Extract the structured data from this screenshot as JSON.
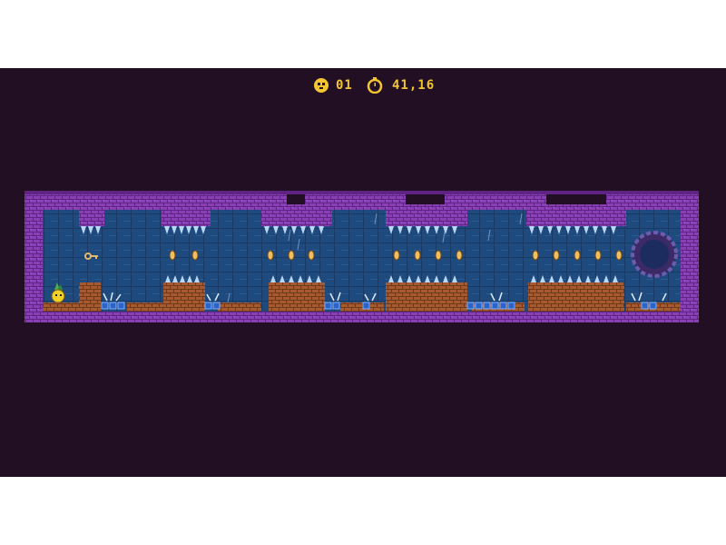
{
  "hud": {
    "deaths_icon": "skull-icon",
    "deaths": "01",
    "timer_icon": "stopwatch-icon",
    "time": "41,16"
  },
  "colors": {
    "background": "#230f24",
    "wall_purple": "#8a3fb8",
    "wall_purple_dark": "#5e2383",
    "water_blue": "#1f4a7e",
    "water_tile": "#2a5a92",
    "brick": "#a65a32",
    "brick_dark": "#6e3a1e",
    "crystal": "#b9d8f5",
    "coin": "#f0c060",
    "hud_yellow": "#f2c531"
  },
  "sprites": {
    "player": "pineapple-player",
    "key": "key-icon",
    "portal": "exit-portal",
    "coin": "coin-icon"
  }
}
